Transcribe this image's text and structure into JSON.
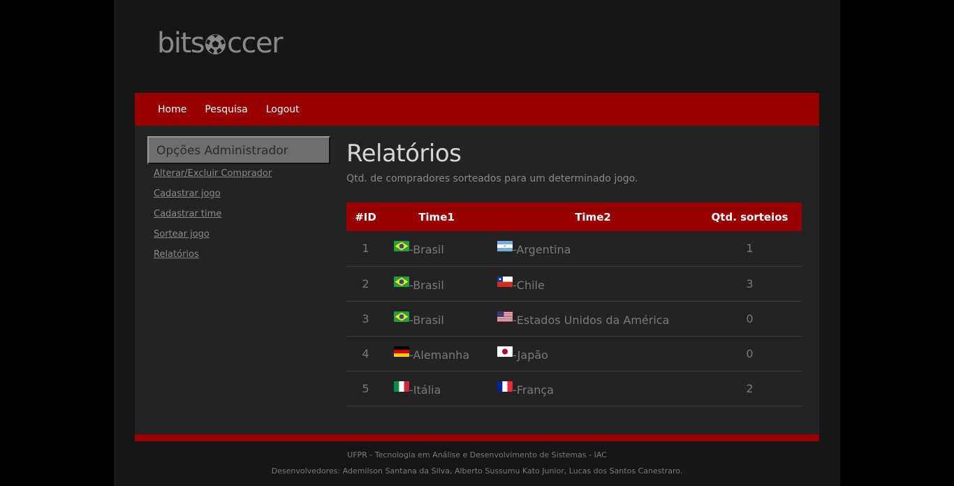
{
  "logo": {
    "before": "bits",
    "after": "ccer"
  },
  "nav": [
    "Home",
    "Pesquisa",
    "Logout"
  ],
  "sidebar": {
    "title": "Opções Administrador",
    "links": [
      "Alterar/Excluir Comprador",
      "Cadastrar jogo",
      "Cadastrar time",
      "Sortear jogo",
      "Relatórios"
    ]
  },
  "main": {
    "title": "Relatórios",
    "subtitle": "Qtd. de compradores sorteados para um determinado jogo."
  },
  "table": {
    "headers": [
      "#ID",
      "Time1",
      "Time2",
      "Qtd. sorteios"
    ],
    "rows": [
      {
        "id": "1",
        "team1": "-Brasil",
        "flag1": "brazil-flag-icon",
        "team2": "-Argentina",
        "flag2": "argentina-flag-icon",
        "qty": "1"
      },
      {
        "id": "2",
        "team1": "-Brasil",
        "flag1": "brazil-flag-icon",
        "team2": "-Chile",
        "flag2": "chile-flag-icon",
        "qty": "3"
      },
      {
        "id": "3",
        "team1": "-Brasil",
        "flag1": "brazil-flag-icon",
        "team2": "-Estados Unidos da América",
        "flag2": "usa-flag-icon",
        "qty": "0"
      },
      {
        "id": "4",
        "team1": "-Alemanha",
        "flag1": "germany-flag-icon",
        "team2": "-Japão",
        "flag2": "japan-flag-icon",
        "qty": "0"
      },
      {
        "id": "5",
        "team1": "-Itália",
        "flag1": "italy-flag-icon",
        "team2": "-França",
        "flag2": "france-flag-icon",
        "qty": "2"
      }
    ]
  },
  "footer": {
    "line1": "UFPR - Tecnologia em Análise e Desenvolvimento de Sistemas - IAC",
    "line2": "Desenvolvedores: Ademilson Santana da Silva, Alberto Sussumu Kato Junior, Lucas dos Santos Canestraro."
  },
  "colors": {
    "accent": "#990000",
    "page": "#161616",
    "content": "#232323",
    "background": "#000000"
  }
}
